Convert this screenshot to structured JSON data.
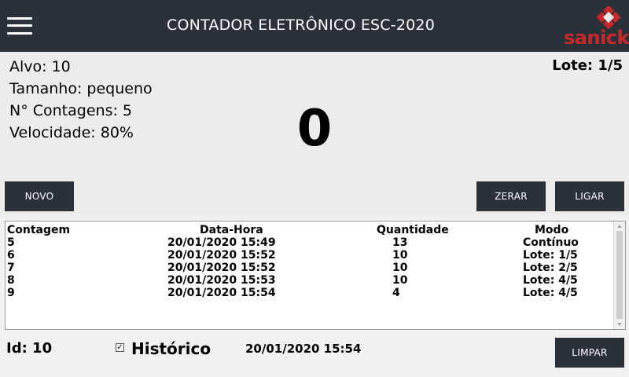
{
  "header": {
    "title": "CONTADOR ELETRÔNICO ESC-2020",
    "logo_text": "sanick",
    "brand_color": "#c7282c",
    "bar_color": "#2b3138"
  },
  "info": {
    "alvo": "Alvo: 10",
    "tamanho": "Tamanho: pequeno",
    "contagens": "N° Contagens: 5",
    "velocidade": "Velocidade: 80%",
    "lote": "Lote: 1/5",
    "counter": "0"
  },
  "buttons": {
    "novo": "NOVO",
    "zerar": "ZERAR",
    "ligar": "LIGAR",
    "limpar": "LIMPAR"
  },
  "table": {
    "columns": [
      "Contagem",
      "Data-Hora",
      "Quantidade",
      "Modo"
    ],
    "rows": [
      [
        "5",
        "20/01/2020 15:49",
        "13",
        "Contínuo"
      ],
      [
        "6",
        "20/01/2020 15:52",
        "10",
        "Lote: 1/5"
      ],
      [
        "7",
        "20/01/2020 15:52",
        "10",
        "Lote: 2/5"
      ],
      [
        "8",
        "20/01/2020 15:53",
        "10",
        "Lote: 4/5"
      ],
      [
        "9",
        "20/01/2020 15:54",
        "4",
        "Lote: 4/5"
      ]
    ]
  },
  "footer": {
    "id": "Id: 10",
    "historico_checked": true,
    "historico_mark": "✓",
    "historico_label": "Histórico",
    "date": "20/01/2020 15:54"
  },
  "icons": {
    "menu": "hamburger-menu-icon",
    "logo": "sanick-logo-icon",
    "checkbox": "check-icon"
  }
}
